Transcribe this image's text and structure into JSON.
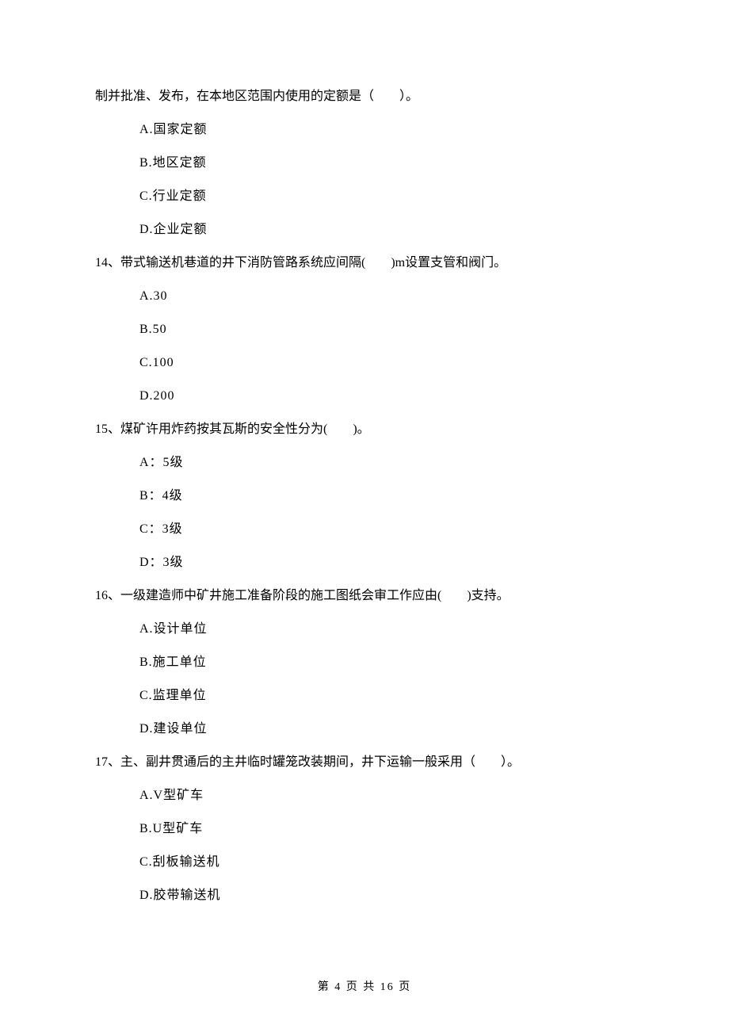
{
  "q13": {
    "stem": "制并批准、发布，在本地区范围内使用的定额是（　　）。",
    "options": {
      "A": "A.国家定额",
      "B": "B.地区定额",
      "C": "C.行业定额",
      "D": "D.企业定额"
    }
  },
  "q14": {
    "stem": "14、带式输送机巷道的井下消防管路系统应间隔(　　)m设置支管和阀门。",
    "options": {
      "A": "A.30",
      "B": "B.50",
      "C": "C.100",
      "D": "D.200"
    }
  },
  "q15": {
    "stem": "15、煤矿许用炸药按其瓦斯的安全性分为(　　)。",
    "options": {
      "A": "A：5级",
      "B": "B：4级",
      "C": "C：3级",
      "D": "D：3级"
    }
  },
  "q16": {
    "stem": "16、一级建造师中矿井施工准备阶段的施工图纸会审工作应由(　　)支持。",
    "options": {
      "A": "A.设计单位",
      "B": "B.施工单位",
      "C": "C.监理单位",
      "D": "D.建设单位"
    }
  },
  "q17": {
    "stem": "17、主、副井贯通后的主井临时罐笼改装期间，井下运输一般采用（　　）。",
    "options": {
      "A": "A.V型矿车",
      "B": "B.U型矿车",
      "C": "C.刮板输送机",
      "D": "D.胶带输送机"
    }
  },
  "footer": "第 4 页 共 16 页"
}
